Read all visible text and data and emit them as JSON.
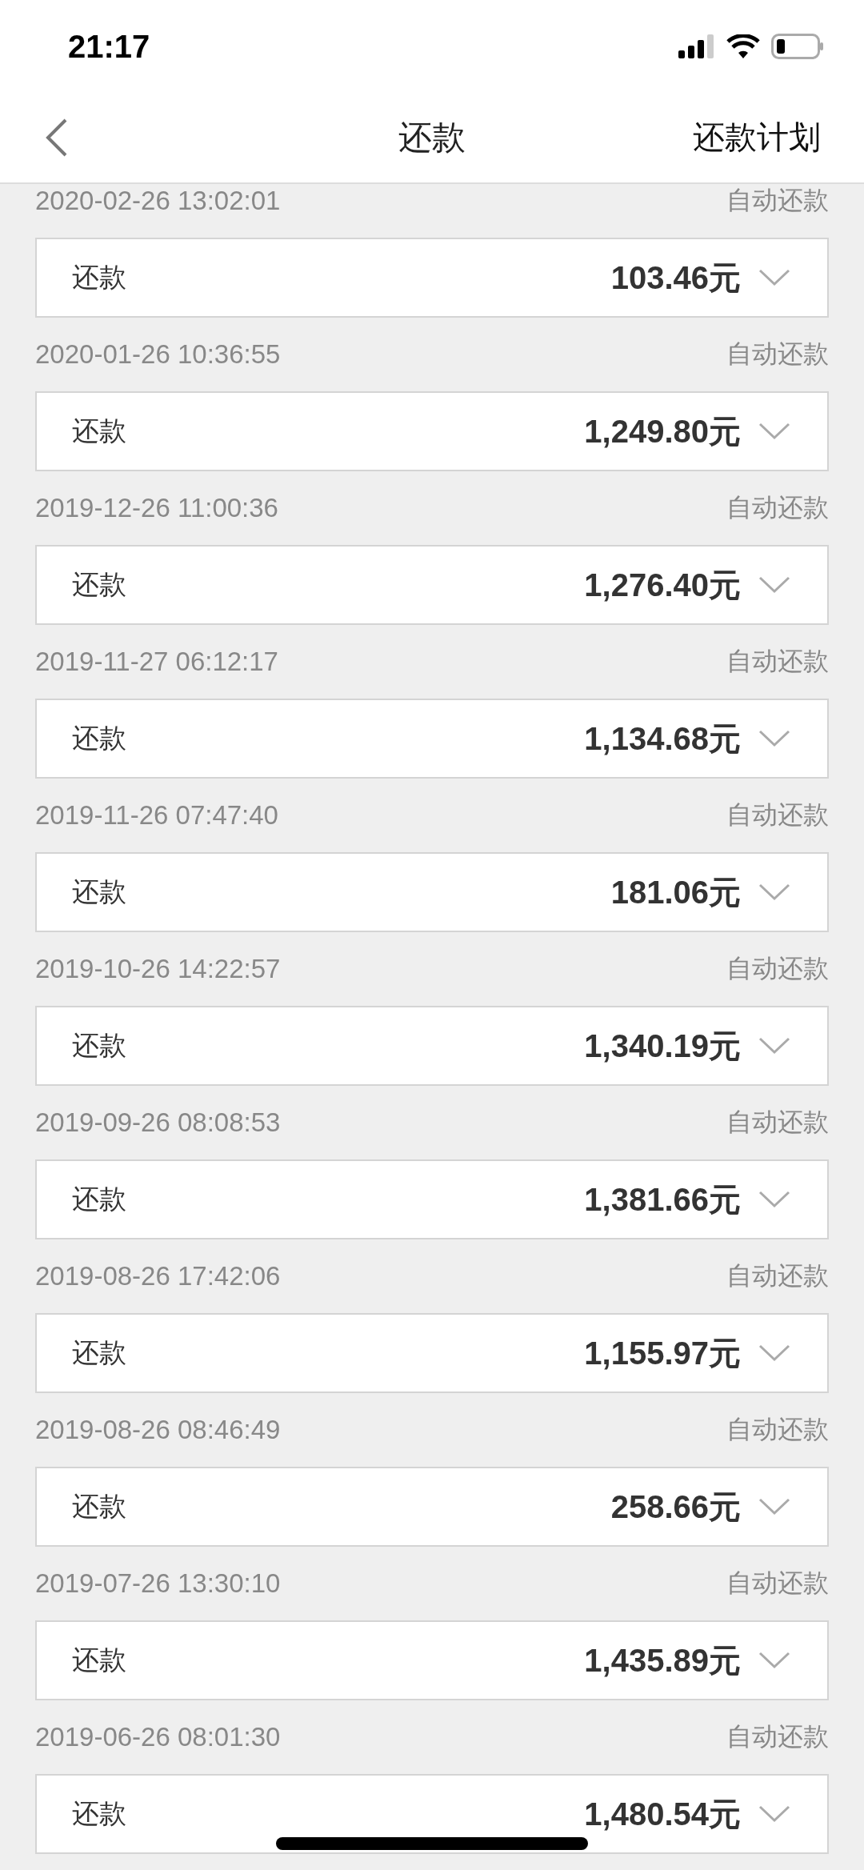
{
  "status_bar": {
    "time": "21:17"
  },
  "nav": {
    "title": "还款",
    "action": "还款计划"
  },
  "records": [
    {
      "date": "2020-02-26 13:02:01",
      "type": "自动还款",
      "label": "还款",
      "amount": "103.46元",
      "expanded": false
    },
    {
      "date": "2020-01-26 10:36:55",
      "type": "自动还款",
      "label": "还款",
      "amount": "1,249.80元",
      "expanded": false
    },
    {
      "date": "2019-12-26 11:00:36",
      "type": "自动还款",
      "label": "还款",
      "amount": "1,276.40元",
      "expanded": false
    },
    {
      "date": "2019-11-27 06:12:17",
      "type": "自动还款",
      "label": "还款",
      "amount": "1,134.68元",
      "expanded": false
    },
    {
      "date": "2019-11-26 07:47:40",
      "type": "自动还款",
      "label": "还款",
      "amount": "181.06元",
      "expanded": false
    },
    {
      "date": "2019-10-26 14:22:57",
      "type": "自动还款",
      "label": "还款",
      "amount": "1,340.19元",
      "expanded": false
    },
    {
      "date": "2019-09-26 08:08:53",
      "type": "自动还款",
      "label": "还款",
      "amount": "1,381.66元",
      "expanded": false
    },
    {
      "date": "2019-08-26 17:42:06",
      "type": "自动还款",
      "label": "还款",
      "amount": "1,155.97元",
      "expanded": false
    },
    {
      "date": "2019-08-26 08:46:49",
      "type": "自动还款",
      "label": "还款",
      "amount": "258.66元",
      "expanded": false
    },
    {
      "date": "2019-07-26 13:30:10",
      "type": "自动还款",
      "label": "还款",
      "amount": "1,435.89元",
      "expanded": false
    },
    {
      "date": "2019-06-26 08:01:30",
      "type": "自动还款",
      "label": "还款",
      "amount": "1,480.54元",
      "expanded": false
    }
  ]
}
